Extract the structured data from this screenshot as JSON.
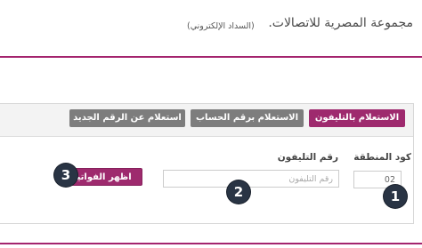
{
  "header": {
    "company_name": "مجموعة المصرية للاتصالات.",
    "service_name": "(السداد الإلكتروني)"
  },
  "tabs": [
    {
      "label": "الاستعلام بالتليفون",
      "active": true
    },
    {
      "label": "الاستعلام برقم الحساب",
      "active": false
    },
    {
      "label": "استعلام عن الرقم الجديد",
      "active": false
    }
  ],
  "form": {
    "area_code_label": "كود المنطقة",
    "area_code_value": "02",
    "phone_label": "رقم التليفون",
    "phone_placeholder": "رقم التليفون",
    "phone_value": "",
    "show_bills_label": "اظهر الفواتير"
  },
  "badges": [
    "1",
    "2",
    "3"
  ],
  "colors": {
    "accent": "#9e2a6e",
    "inactive_tab": "#7d7d7d",
    "badge": "#293444"
  }
}
